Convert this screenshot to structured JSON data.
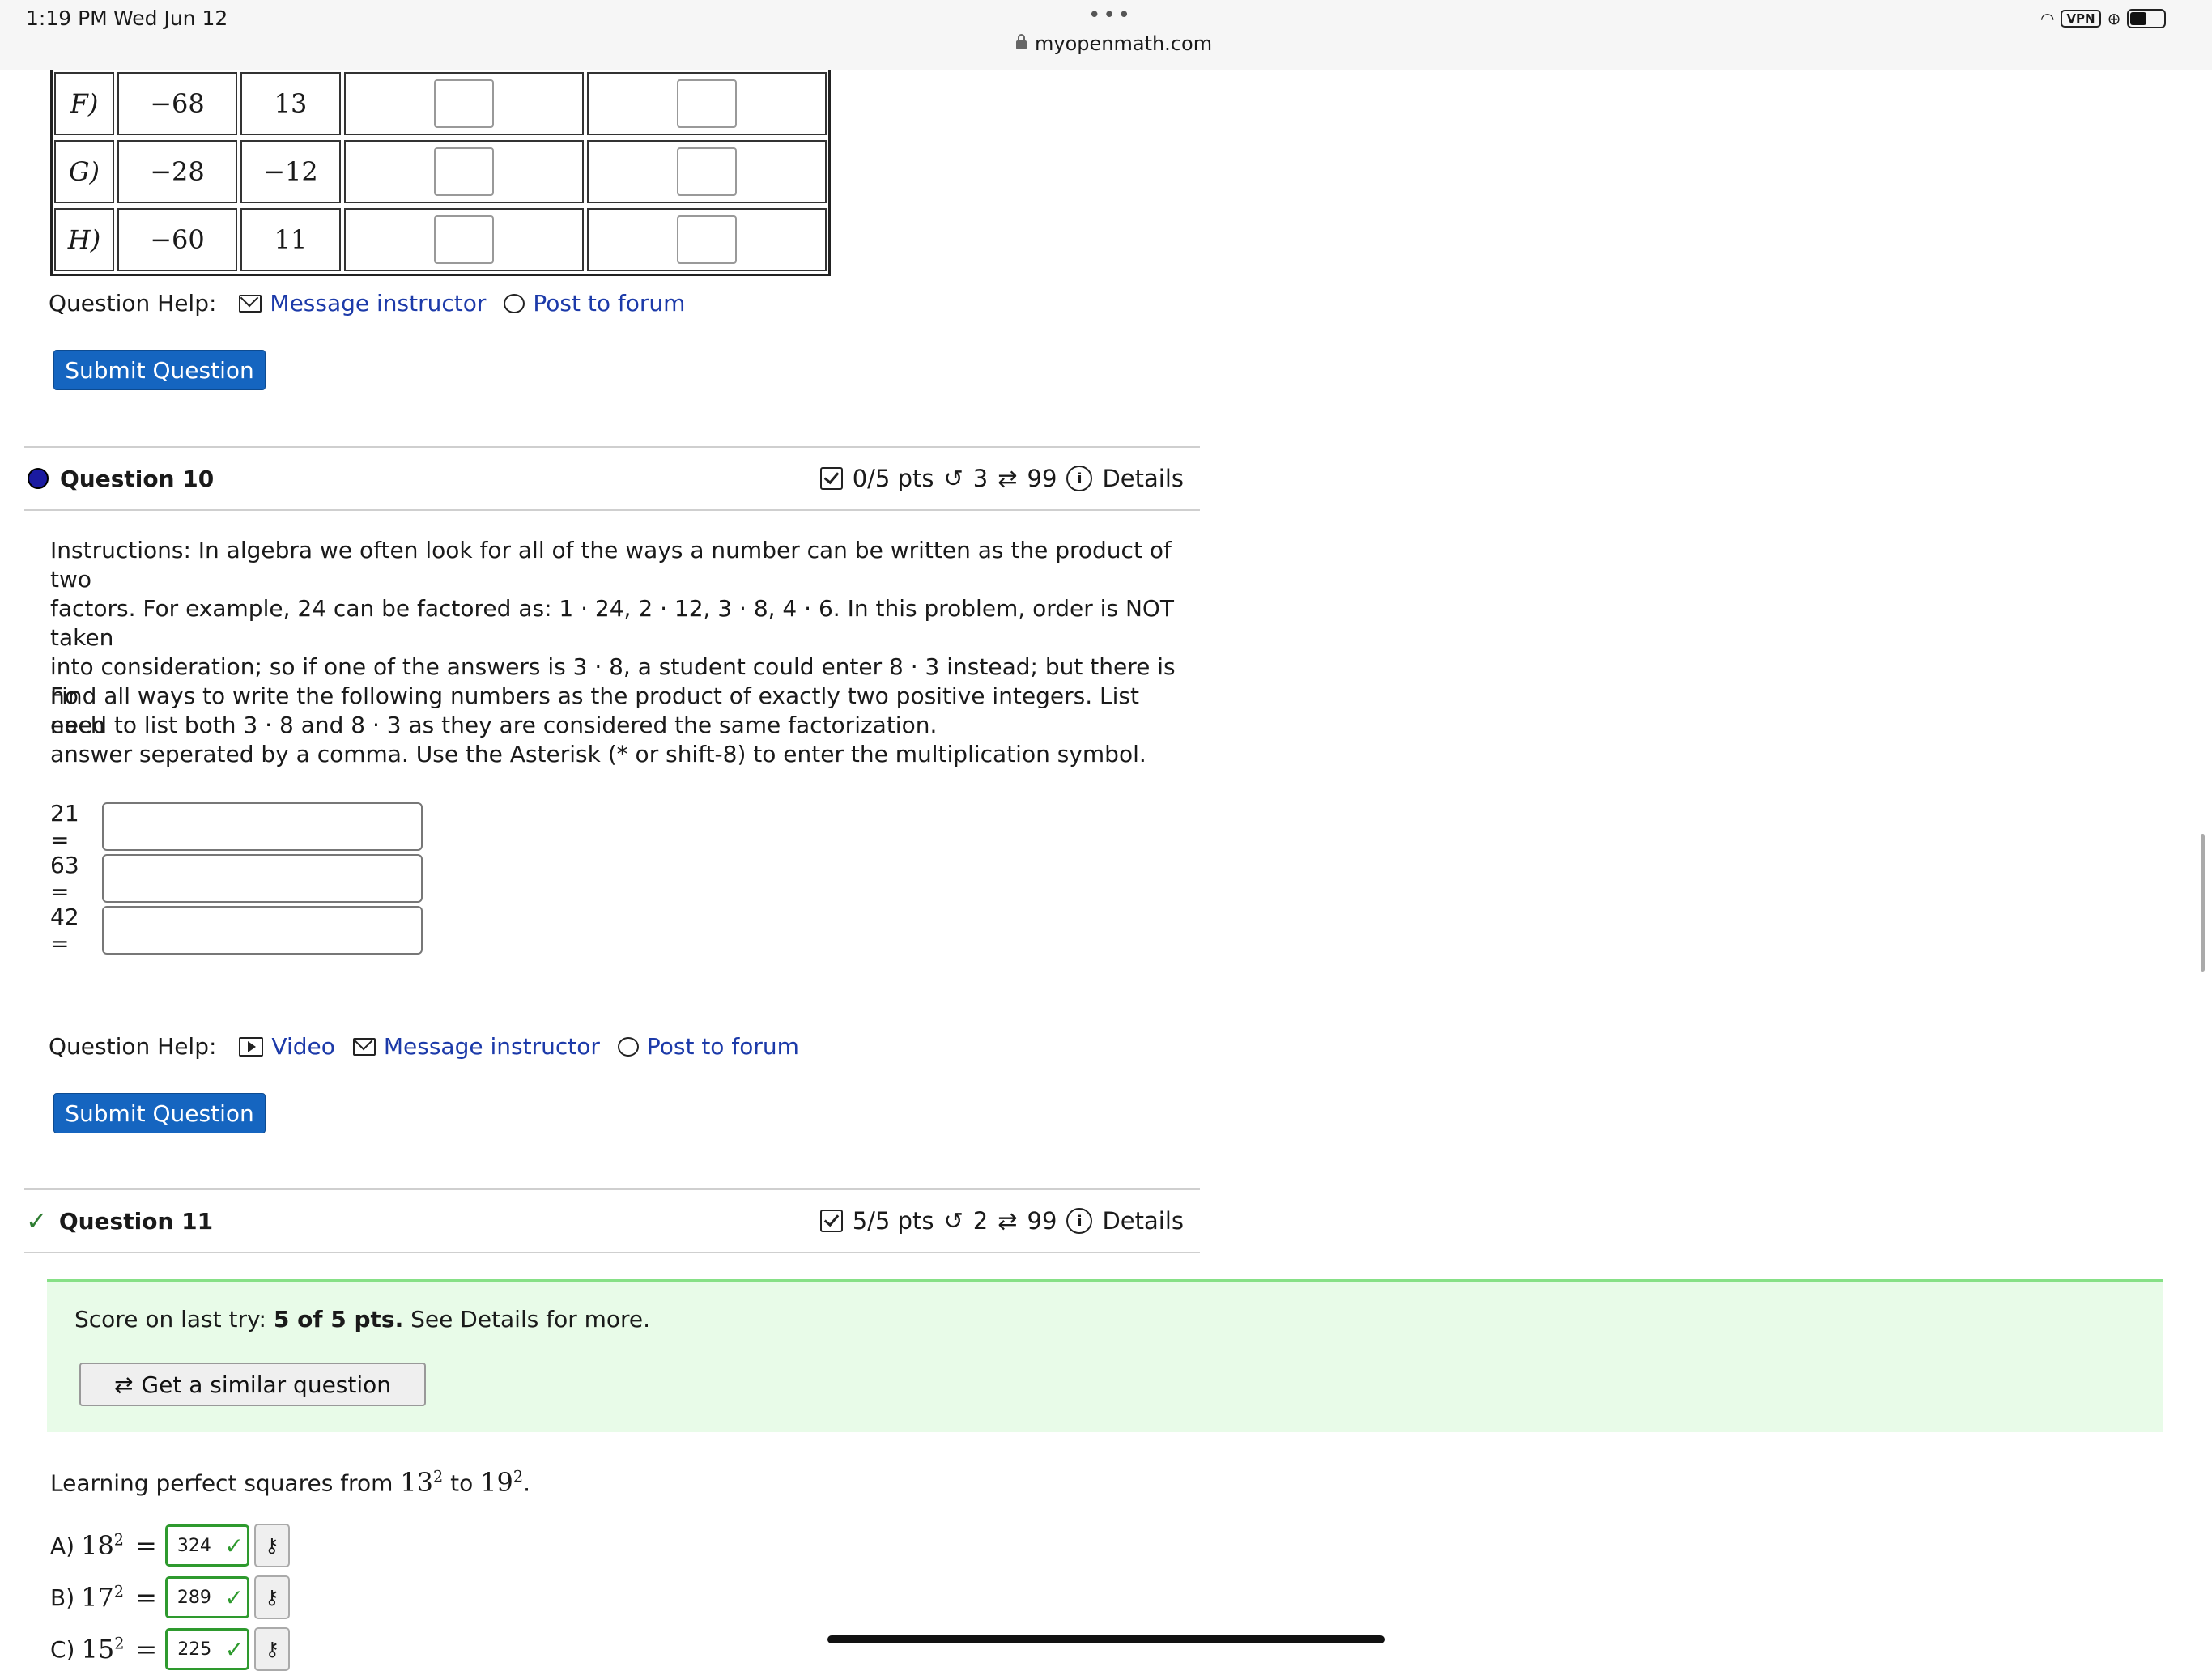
{
  "status": {
    "time": "1:19 PM",
    "date": "Wed Jun 12",
    "url": "myopenmath.com",
    "vpn": "VPN"
  },
  "prev_table": {
    "rows": [
      {
        "label": "F)",
        "a": "−68",
        "b": "13"
      },
      {
        "label": "G)",
        "a": "−28",
        "b": "−12"
      },
      {
        "label": "H)",
        "a": "−60",
        "b": "11"
      }
    ]
  },
  "help1": {
    "label": "Question Help:",
    "message": "Message instructor",
    "forum": "Post to forum"
  },
  "submit_label": "Submit Question",
  "q10": {
    "title": "Question 10",
    "pts": "0/5 pts",
    "retries": "3",
    "versions": "99",
    "details": "Details",
    "p1_line1": "Instructions: In algebra we often look for all of the ways a number can be written as the product of two",
    "p1_line2": "factors. For example, 24 can be factored as: 1 · 24, 2 · 12, 3 · 8, 4 · 6. In this problem, order is NOT taken",
    "p1_line3": "into consideration; so if one of the answers is 3 · 8, a student could enter 8 · 3 instead; but there is no",
    "p1_line4": "need to list both 3 · 8 and 8 · 3 as they are considered the same factorization.",
    "p2_line1": "Find all ways to write the following numbers as the product of exactly two positive integers. List each",
    "p2_line2": "answer seperated by a comma. Use the Asterisk (* or shift-8) to enter the multiplication symbol.",
    "answers": [
      "21 =",
      "63 =",
      "42 ="
    ],
    "help": {
      "label": "Question Help:",
      "video": "Video",
      "message": "Message instructor",
      "forum": "Post to forum"
    }
  },
  "q11": {
    "title": "Question 11",
    "pts": "5/5 pts",
    "retries": "2",
    "versions": "99",
    "details": "Details",
    "score_prefix": "Score on last try: ",
    "score_bold": "5 of 5 pts.",
    "score_suffix": " See Details for more.",
    "similar": "Get a similar question",
    "intro_pre": "Learning perfect squares from ",
    "intro_a": "13",
    "intro_mid": " to ",
    "intro_b": "19",
    "intro_post": ".",
    "squares": [
      {
        "label": "A)",
        "base": "18",
        "value": "324"
      },
      {
        "label": "B)",
        "base": "17",
        "value": "289"
      },
      {
        "label": "C)",
        "base": "15",
        "value": "225"
      }
    ]
  }
}
